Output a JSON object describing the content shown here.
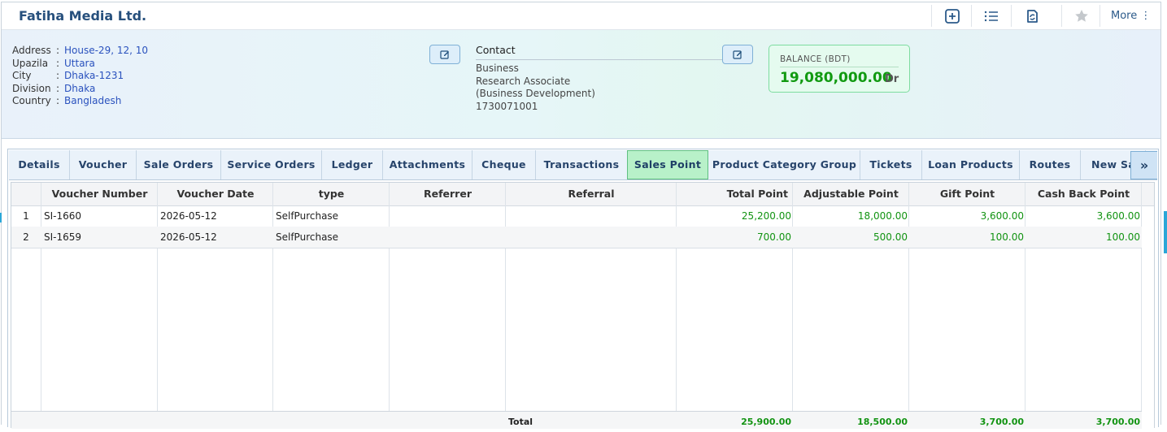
{
  "app": {
    "company_name": "Fatiha Media Ltd."
  },
  "toolbar": {
    "icons": [
      "add-square-icon",
      "list-icon",
      "document-sync-icon",
      "star-icon"
    ],
    "more_label": "More ⋮"
  },
  "address": {
    "rows": [
      {
        "key": "Address",
        "value": "House-29, 12, 10"
      },
      {
        "key": "Upazila",
        "value": "Uttara"
      },
      {
        "key": "City",
        "value": "Dhaka-1231"
      },
      {
        "key": "Division",
        "value": "Dhaka"
      },
      {
        "key": "Country",
        "value": "Bangladesh"
      }
    ]
  },
  "contact": {
    "title": "Contact",
    "lines": [
      "Business",
      "Research Associate",
      "(Business Development)",
      "1730071001"
    ]
  },
  "balance": {
    "label": "BALANCE (BDT)",
    "amount": "19,080,000.00",
    "suffix": "Dr"
  },
  "tabs": {
    "items": [
      "Details",
      "Voucher",
      "Sale Orders",
      "Service Orders",
      "Ledger",
      "Attachments",
      "Cheque",
      "Transactions",
      "Sales Point",
      "Product Category Group",
      "Tickets",
      "Loan Products",
      "Routes",
      "New Sa"
    ],
    "active": "Sales Point",
    "next_label": "»"
  },
  "grid": {
    "columns": [
      "",
      "Voucher Number",
      "Voucher Date",
      "type",
      "Referrer",
      "Referral",
      "Total Point",
      "Adjustable Point",
      "Gift Point",
      "Cash Back Point"
    ],
    "rows": [
      [
        "1",
        "SI-1660",
        "2026-05-12",
        "SelfPurchase",
        "",
        "",
        "25,200.00",
        "18,000.00",
        "3,600.00",
        "3,600.00"
      ],
      [
        "2",
        "SI-1659",
        "2026-05-12",
        "SelfPurchase",
        "",
        "",
        "700.00",
        "500.00",
        "100.00",
        "100.00"
      ]
    ],
    "footer": [
      "",
      "",
      "",
      "",
      "",
      "Total",
      "25,900.00",
      "18,500.00",
      "3,700.00",
      "3,700.00"
    ]
  },
  "colors": {
    "accent": "#27507d",
    "positive": "#129312",
    "active_tab": "#b8f1c9"
  }
}
